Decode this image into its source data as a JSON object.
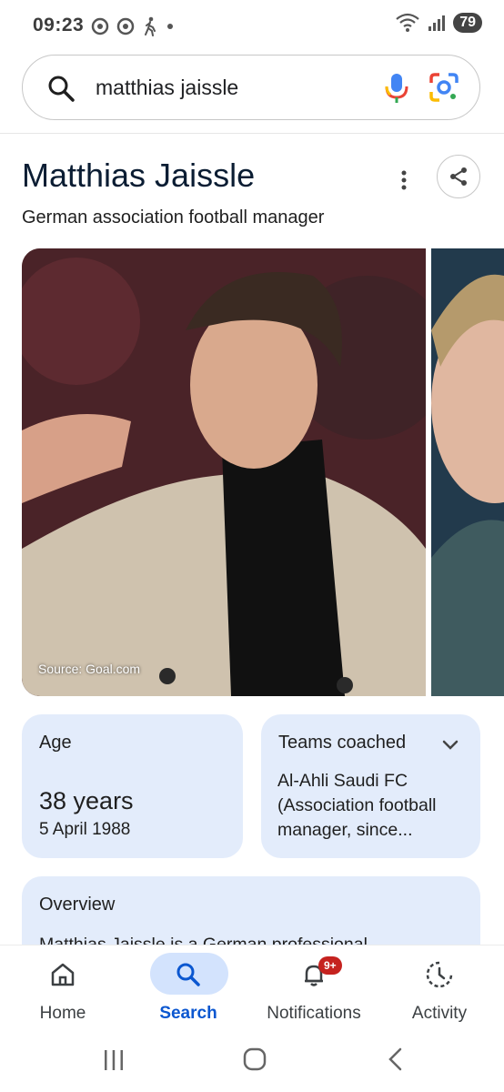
{
  "status_bar": {
    "time": "09:23",
    "battery": "79"
  },
  "search": {
    "query": "matthias jaissle"
  },
  "entity": {
    "name": "Matthias Jaissle",
    "description": "German association football manager",
    "image_source": "Source: Goal.com"
  },
  "facts": {
    "age_label": "Age",
    "age_value": "38 years",
    "birth_date": "5 April 1988",
    "teams_label": "Teams coached",
    "teams_value": "Al-Ahli Saudi FC (Association football manager, since..."
  },
  "overview": {
    "label": "Overview",
    "snippet": "Matthias Jaissle is a German professional"
  },
  "bottom_nav": {
    "items": [
      {
        "label": "Home",
        "icon": "home-icon"
      },
      {
        "label": "Search",
        "icon": "search-icon"
      },
      {
        "label": "Notifications",
        "icon": "bell-icon",
        "badge": "9+"
      },
      {
        "label": "Activity",
        "icon": "activity-icon"
      }
    ],
    "active": "Search"
  },
  "colors": {
    "accent": "#0b57d0",
    "card_bg": "#e3ecfb",
    "active_pill": "#d3e3fd",
    "badge": "#c5221f"
  }
}
